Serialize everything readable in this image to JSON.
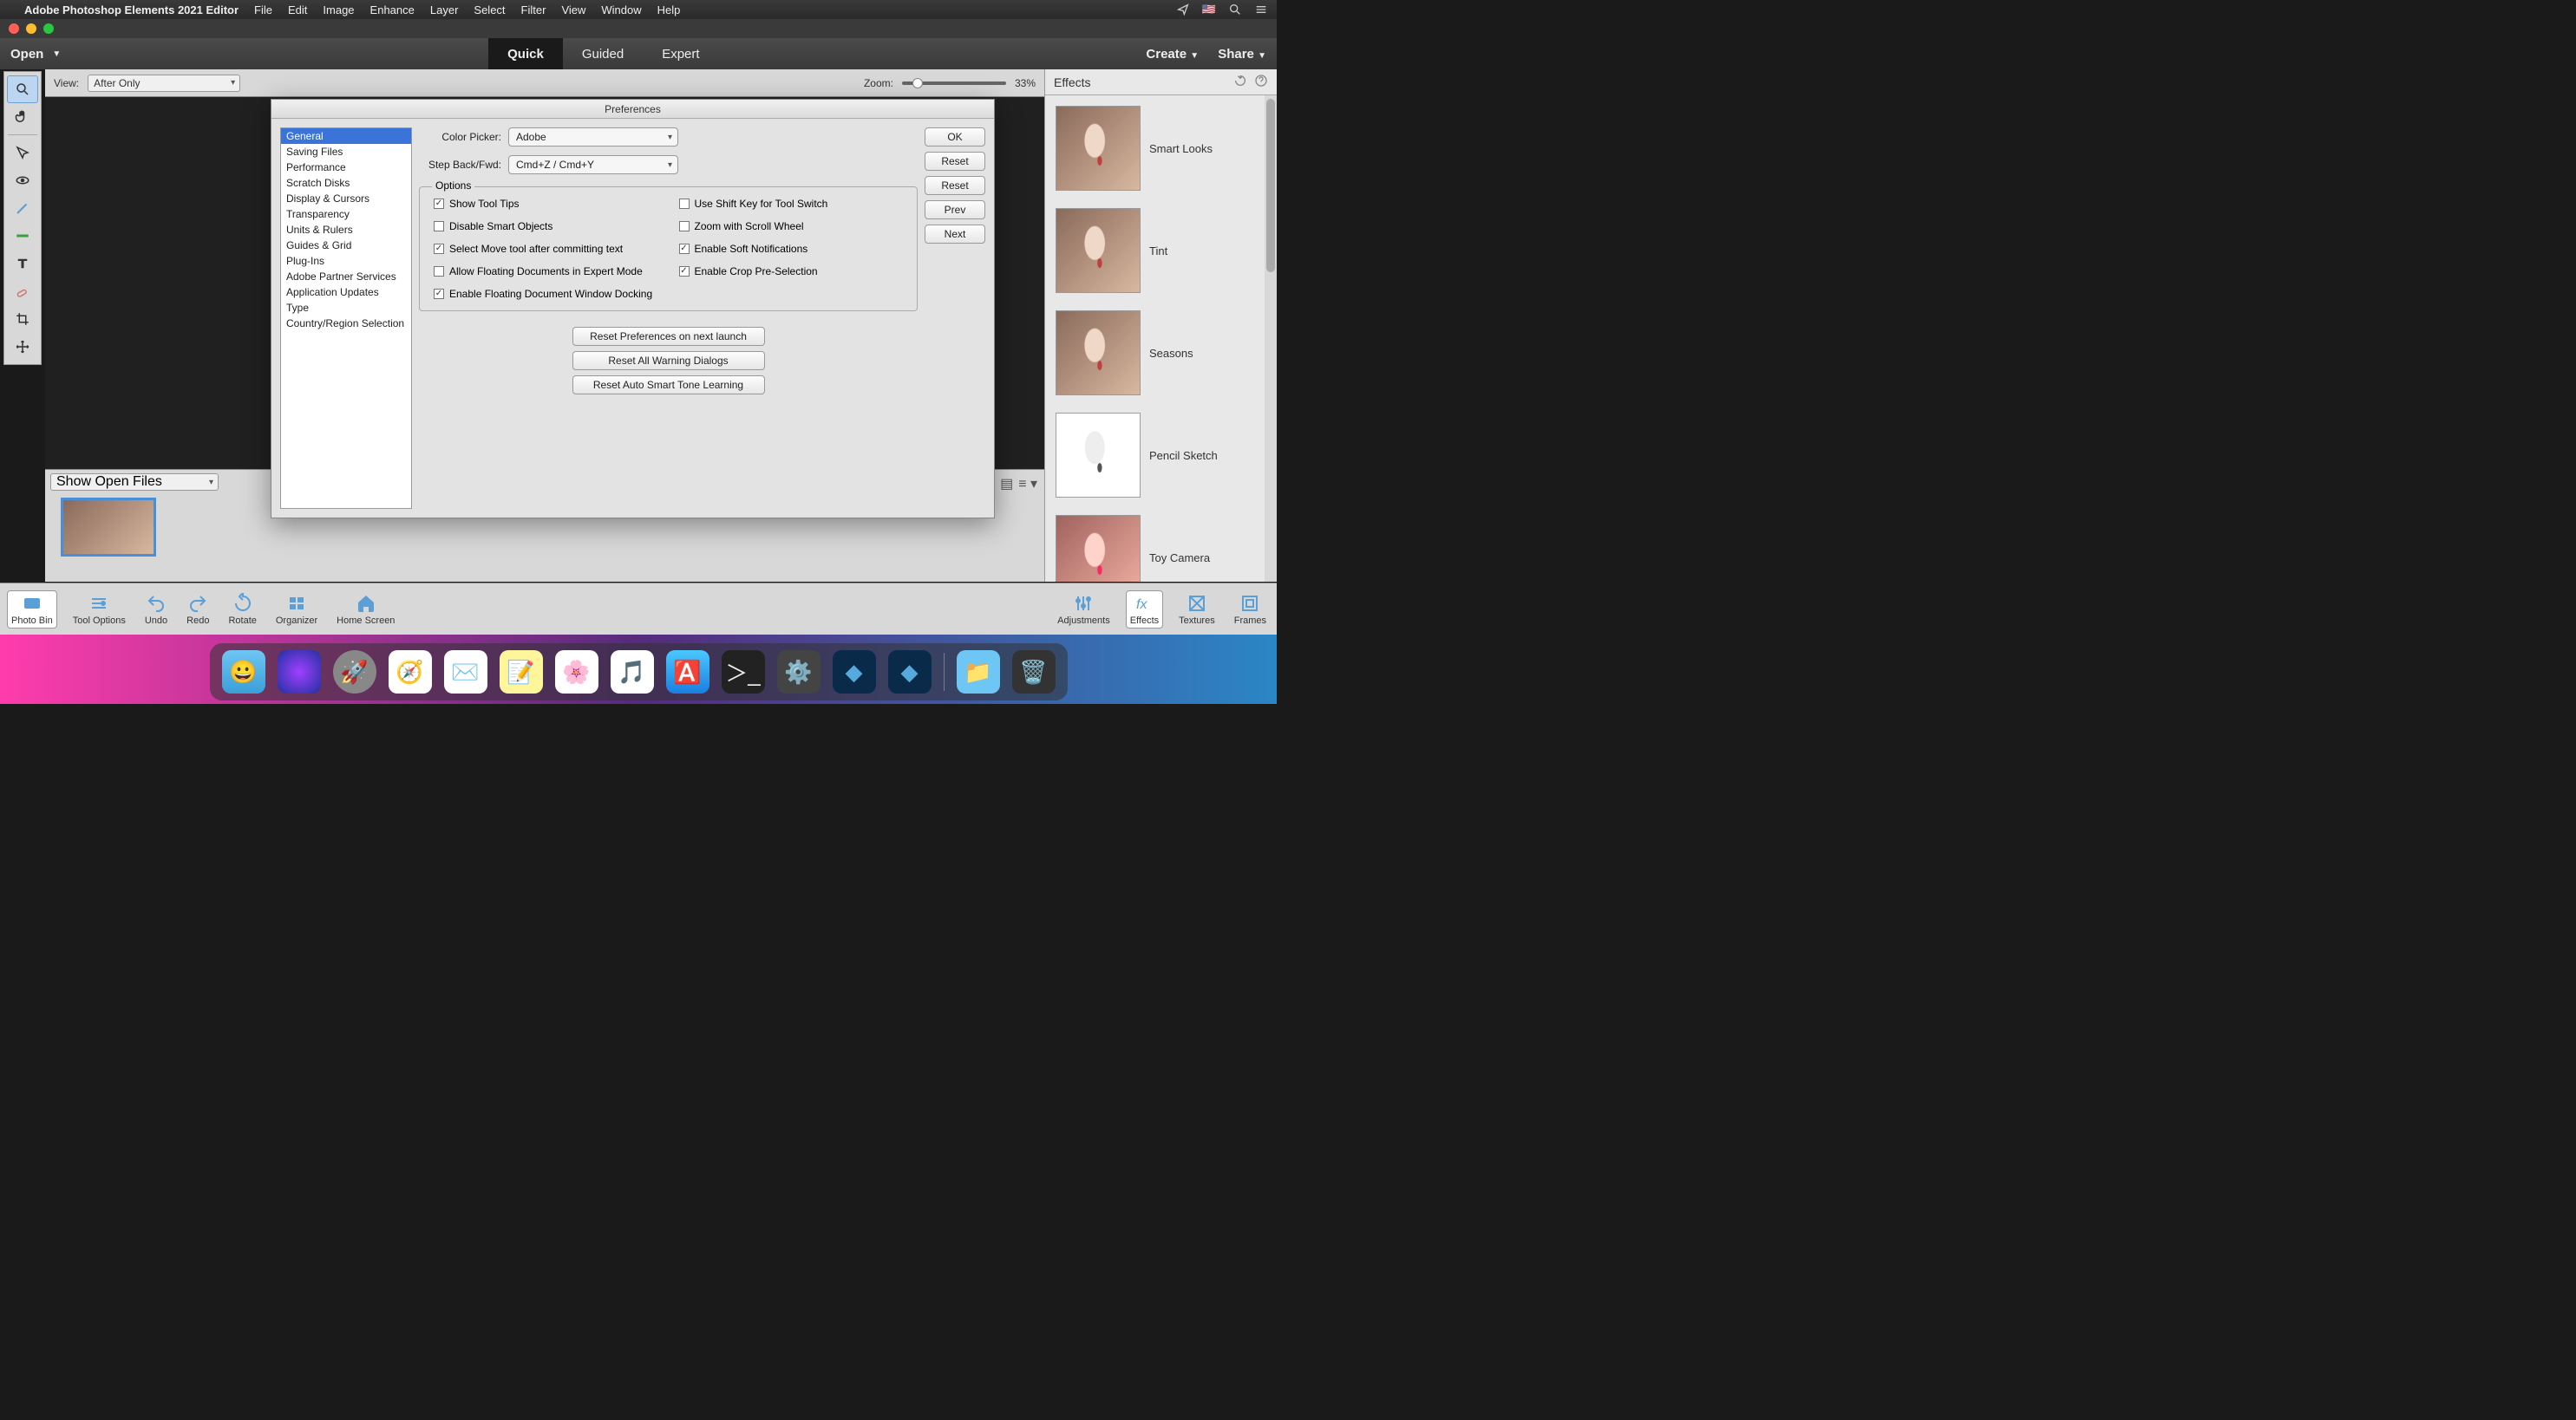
{
  "menubar": {
    "app": "Adobe Photoshop Elements 2021 Editor",
    "items": [
      "File",
      "Edit",
      "Image",
      "Enhance",
      "Layer",
      "Select",
      "Filter",
      "View",
      "Window",
      "Help"
    ]
  },
  "topbar": {
    "open": "Open",
    "tabs": [
      "Quick",
      "Guided",
      "Expert"
    ],
    "active_tab": 0,
    "create": "Create",
    "share": "Share"
  },
  "subbar": {
    "view_label": "View:",
    "view_value": "After Only",
    "zoom_label": "Zoom:",
    "zoom_value": "33%"
  },
  "tools": [
    "zoom",
    "hand",
    "quick-select",
    "eye",
    "whiten",
    "straighten",
    "text",
    "spot-heal",
    "crop",
    "move"
  ],
  "effects": {
    "title": "Effects",
    "items": [
      "Smart Looks",
      "Tint",
      "Seasons",
      "Pencil Sketch",
      "Toy Camera"
    ]
  },
  "bin": {
    "select": "Show Open Files"
  },
  "actionbar": {
    "left": [
      "Photo Bin",
      "Tool Options",
      "Undo",
      "Redo",
      "Rotate",
      "Organizer",
      "Home Screen"
    ],
    "right": [
      "Adjustments",
      "Effects",
      "Textures",
      "Frames"
    ]
  },
  "prefs": {
    "title": "Preferences",
    "categories": [
      "General",
      "Saving Files",
      "Performance",
      "Scratch Disks",
      "Display & Cursors",
      "Transparency",
      "Units & Rulers",
      "Guides & Grid",
      "Plug-Ins",
      "Adobe Partner Services",
      "Application Updates",
      "Type",
      "Country/Region Selection"
    ],
    "selected_category": 0,
    "color_picker_label": "Color Picker:",
    "color_picker_value": "Adobe",
    "step_label": "Step Back/Fwd:",
    "step_value": "Cmd+Z / Cmd+Y",
    "options_legend": "Options",
    "checks": [
      {
        "label": "Show Tool Tips",
        "checked": true
      },
      {
        "label": "Use Shift Key for Tool Switch",
        "checked": false
      },
      {
        "label": "Disable Smart Objects",
        "checked": false
      },
      {
        "label": "Zoom with Scroll Wheel",
        "checked": false
      },
      {
        "label": "Select Move tool after committing text",
        "checked": true
      },
      {
        "label": "Enable Soft Notifications",
        "checked": true
      },
      {
        "label": "Allow Floating Documents in Expert Mode",
        "checked": false
      },
      {
        "label": "Enable Crop Pre-Selection",
        "checked": true
      },
      {
        "label": "Enable Floating Document Window Docking",
        "checked": true
      }
    ],
    "reset_buttons": [
      "Reset Preferences on next launch",
      "Reset All Warning Dialogs",
      "Reset Auto Smart Tone Learning"
    ],
    "side_buttons": [
      "OK",
      "Reset",
      "Reset",
      "Prev",
      "Next"
    ]
  },
  "dock": [
    "finder",
    "siri",
    "launchpad",
    "safari",
    "mail",
    "notes",
    "photos",
    "music",
    "appstore",
    "terminal",
    "settings",
    "pse-organizer",
    "pse-editor",
    "downloads",
    "trash"
  ]
}
